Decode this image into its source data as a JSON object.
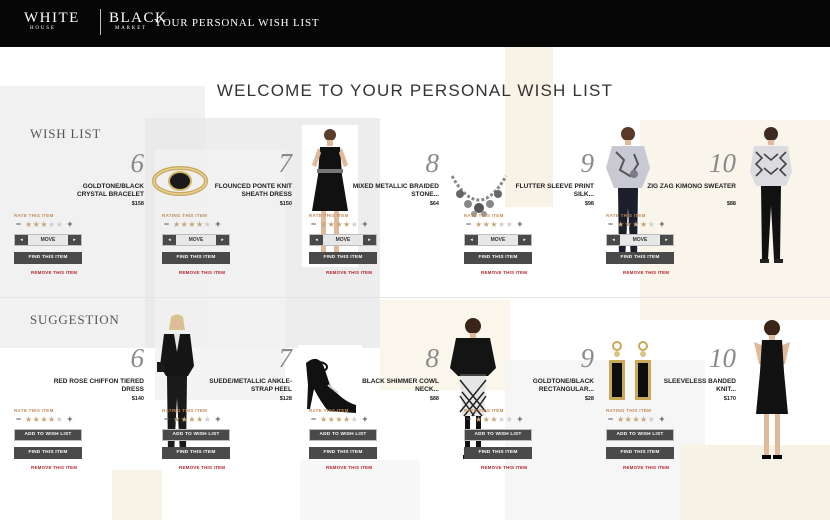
{
  "header": {
    "logo_left": "WHITE",
    "logo_left_sub": "HOUSE",
    "logo_right": "BLACK",
    "logo_right_sub": "MARKET",
    "title": "YOUR PERSONAL WISH LIST"
  },
  "page_title": "WELCOME TO YOUR PERSONAL WISH LIST",
  "wish_list": {
    "label": "WISH LIST",
    "items": [
      {
        "num": "6",
        "name": "GOLDTONE/BLACK CRYSTAL BRACELET",
        "price": "$158",
        "rate_label": "RATE THIS ITEM",
        "stars": 3,
        "move_label": "MOVE",
        "find_label": "FIND THIS ITEM",
        "remove_label": "REMOVE THIS ITEM",
        "image": "bracelet"
      },
      {
        "num": "7",
        "name": "FLOUNCED PONTE KNIT SHEATH DRESS",
        "price": "$150",
        "rate_label": "RATING THIS ITEM",
        "stars": 4,
        "move_label": "MOVE",
        "find_label": "FIND THIS ITEM",
        "remove_label": "REMOVE THIS ITEM",
        "image": "black-dress"
      },
      {
        "num": "8",
        "name": "MIXED METALLIC BRAIDED STONE...",
        "price": "$64",
        "rate_label": "RATE THIS ITEM",
        "stars": 4,
        "move_label": "MOVE",
        "find_label": "FIND THIS ITEM",
        "remove_label": "REMOVE THIS ITEM",
        "image": "necklace"
      },
      {
        "num": "9",
        "name": "FLUTTER SLEEVE PRINT SILK...",
        "price": "$98",
        "rate_label": "RATE THIS ITEM",
        "stars": 3,
        "move_label": "MOVE",
        "find_label": "FIND THIS ITEM",
        "remove_label": "REMOVE THIS ITEM",
        "image": "print-top"
      },
      {
        "num": "10",
        "name": "ZIG ZAG KIMONO SWEATER",
        "price": "$88",
        "rate_label": "RATE THIS ITEM",
        "stars": 4,
        "move_label": "MOVE",
        "find_label": "FIND THIS ITEM",
        "remove_label": "REMOVE THIS ITEM",
        "image": "kimono"
      }
    ]
  },
  "suggestion": {
    "label": "SUGGESTION",
    "items": [
      {
        "num": "6",
        "name": "RED ROSE CHIFFON TIERED DRESS",
        "price": "$140",
        "rate_label": "RATE THIS ITEM",
        "stars": 4,
        "add_label": "ADD TO WISH LIST",
        "find_label": "FIND THIS ITEM",
        "remove_label": "REMOVE THIS ITEM",
        "image": "suit"
      },
      {
        "num": "7",
        "name": "SUEDE/METALLIC ANKLE-STRAP HEEL",
        "price": "$128",
        "rate_label": "RATING THIS ITEM",
        "stars": 4,
        "add_label": "ADD TO WISH LIST",
        "find_label": "FIND THIS ITEM",
        "remove_label": "REMOVE THIS ITEM",
        "image": "heel"
      },
      {
        "num": "8",
        "name": "BLACK SHIMMER COWL NECK...",
        "price": "$88",
        "rate_label": "RATE THIS ITEM",
        "stars": 4,
        "add_label": "ADD TO WISH LIST",
        "find_label": "FIND THIS ITEM",
        "remove_label": "REMOVE THIS ITEM",
        "image": "cowl"
      },
      {
        "num": "9",
        "name": "GOLDTONE/BLACK RECTANGULAR...",
        "price": "$28",
        "rate_label": "RATE THIS ITEM",
        "stars": 3,
        "add_label": "ADD TO WISH LIST",
        "find_label": "FIND THIS ITEM",
        "remove_label": "REMOVE THIS ITEM",
        "image": "earrings"
      },
      {
        "num": "10",
        "name": "SLEEVELESS BANDED KNIT...",
        "price": "$170",
        "rate_label": "RATING THIS ITEM",
        "stars": 4,
        "add_label": "ADD TO WISH LIST",
        "find_label": "FIND THIS ITEM",
        "remove_label": "REMOVE THIS ITEM",
        "image": "sleeveless"
      }
    ]
  },
  "colors": {
    "header_bg": "#060606",
    "button_dark": "#4a4a4a",
    "remove_red": "#b4232c",
    "rate_label": "#c28a56",
    "star_gold": "#c4a77a"
  }
}
